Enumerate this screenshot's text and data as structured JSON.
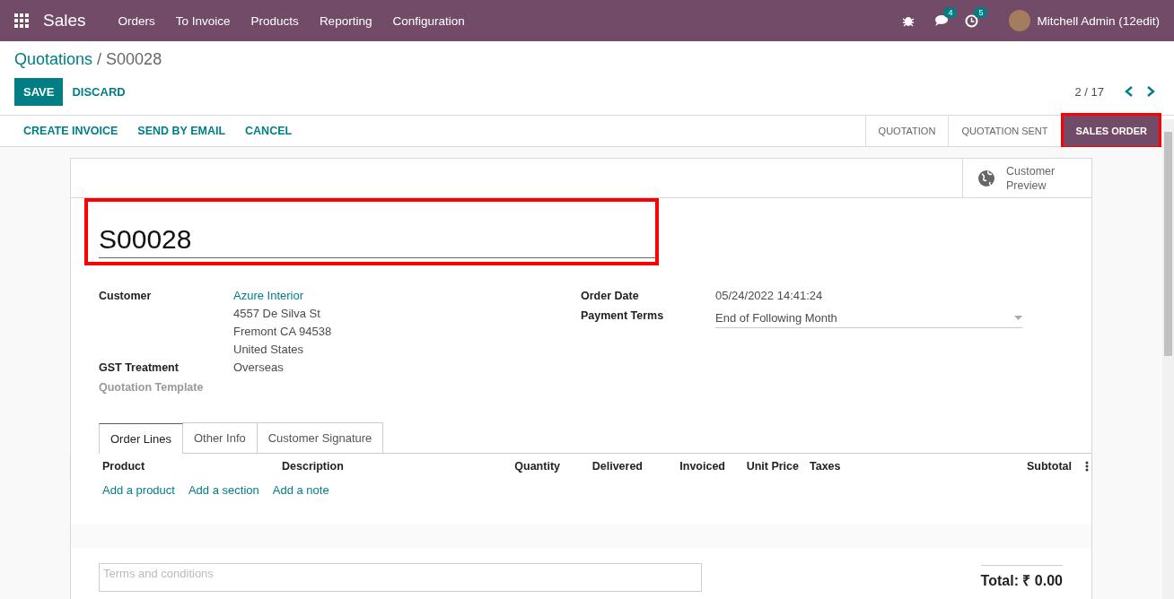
{
  "navbar": {
    "app": "Sales",
    "menu": [
      "Orders",
      "To Invoice",
      "Products",
      "Reporting",
      "Configuration"
    ],
    "messages_count": "4",
    "activities_count": "5",
    "user": "Mitchell Admin (12edit)"
  },
  "breadcrumb": {
    "parent": "Quotations",
    "separator": "/",
    "current": "S00028"
  },
  "buttons": {
    "save": "SAVE",
    "discard": "DISCARD"
  },
  "pager": "2 / 17",
  "actions": [
    "CREATE INVOICE",
    "SEND BY EMAIL",
    "CANCEL"
  ],
  "stages": [
    {
      "label": "QUOTATION",
      "selected": false
    },
    {
      "label": "QUOTATION SENT",
      "selected": false
    },
    {
      "label": "SALES ORDER",
      "selected": true,
      "highlighted": true
    }
  ],
  "smart_button": "Customer Preview",
  "order_name": {
    "value": "S00028",
    "highlighted": true
  },
  "left_fields": [
    {
      "label": "Customer",
      "kind": "link",
      "value": "Azure Interior",
      "lines": [
        "4557 De Silva St",
        "Fremont CA 94538",
        "United States"
      ]
    },
    {
      "label": "GST Treatment",
      "kind": "text",
      "value": "Overseas"
    },
    {
      "label": "Quotation Template",
      "kind": "empty"
    }
  ],
  "right_fields": [
    {
      "label": "Order Date",
      "kind": "text",
      "value": "05/24/2022 14:41:24"
    },
    {
      "label": "Payment Terms",
      "kind": "select",
      "value": "End of Following Month"
    }
  ],
  "tabs": [
    {
      "label": "Order Lines",
      "selected": true
    },
    {
      "label": "Other Info",
      "selected": false
    },
    {
      "label": "Customer Signature",
      "selected": false
    }
  ],
  "table": {
    "columns": [
      "Product",
      "Description",
      "Quantity",
      "Delivered",
      "Invoiced",
      "Unit Price",
      "Taxes",
      "Subtotal"
    ],
    "add_links": [
      "Add a product",
      "Add a section",
      "Add a note"
    ]
  },
  "terms": {
    "placeholder": "Terms and conditions"
  },
  "total": "Total: ₹ 0.00"
}
